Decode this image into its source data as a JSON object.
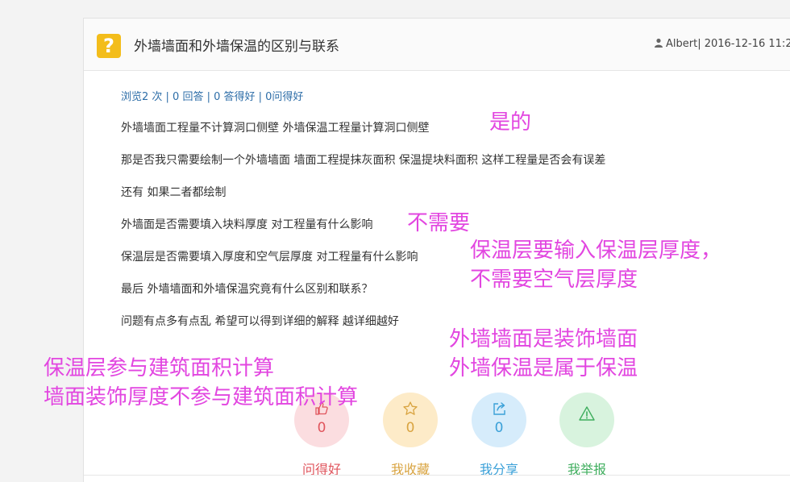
{
  "question": {
    "title": "外墙墙面和外墙保温的区别与联系",
    "meta": "Albert| 2016-12-16 11:2",
    "stats": "浏览2 次 | 0 回答 | 0 答得好 | 0问得好",
    "lines": [
      "外墙墙面工程量不计算洞口侧壁 外墙保温工程量计算洞口侧壁",
      "那是否我只需要绘制一个外墙墙面 墙面工程提抹灰面积 保温提块料面积 这样工程量是否会有误差",
      "还有 如果二者都绘制",
      "外墙面是否需要填入块料厚度 对工程量有什么影响",
      "保温层是否需要填入厚度和空气层厚度 对工程量有什么影响",
      "最后 外墙墙面和外墙保温究竟有什么区别和联系？",
      "问题有点多有点乱 希望可以得到详细的解释 越详细越好"
    ]
  },
  "annotations": {
    "a1": "是的",
    "a2": "不需要",
    "a3_line1": "保温层要输入保温层厚度，",
    "a3_line2": "不需要空气层厚度",
    "a4_line1": "外墙墙面是装饰墙面",
    "a4_line2": "外墙保温是属于保温",
    "a5_line1": "保温层参与建筑面积计算",
    "a5_line2": "墙面装饰厚度不参与建筑面积计算"
  },
  "actions": [
    {
      "label": "问得好",
      "count": "0",
      "icon": "thumbs-up-icon",
      "color": "#e0555d",
      "bg": "#fbdde0"
    },
    {
      "label": "我收藏",
      "count": "0",
      "icon": "star-icon",
      "color": "#d9a441",
      "bg": "#fdebc8"
    },
    {
      "label": "我分享",
      "count": "0",
      "icon": "share-icon",
      "color": "#3aa0d8",
      "bg": "#d6ecfb"
    },
    {
      "label": "我举报",
      "count": "0",
      "icon": "warning-icon",
      "color": "#3fae5e",
      "bg": "#d8f3de"
    }
  ],
  "colors": {
    "annotation": "#e246e0",
    "question_icon": "#f3bd1b",
    "link": "#2e6ea8"
  }
}
